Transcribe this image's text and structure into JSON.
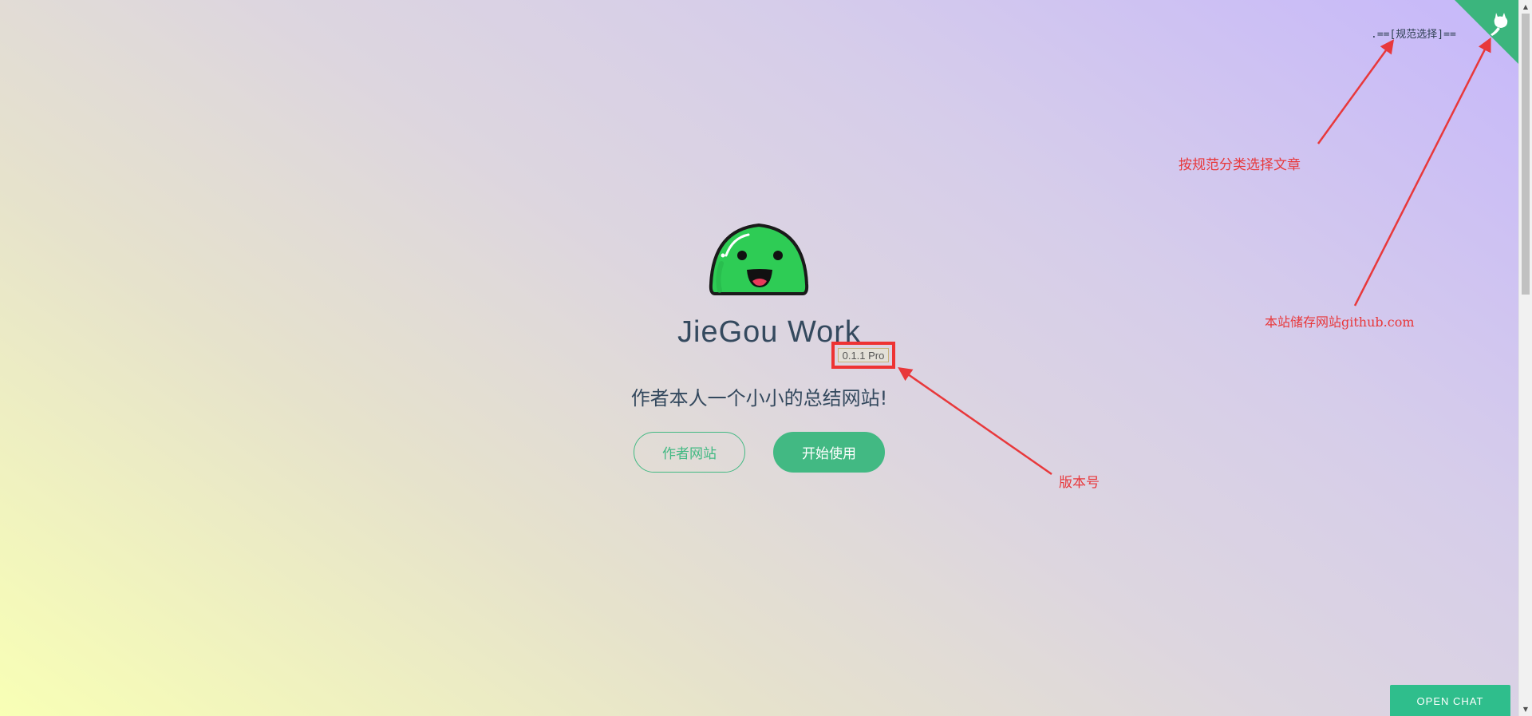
{
  "nav": {
    "category_link": ".==[规范选择]=="
  },
  "hero": {
    "title": "JieGou Work",
    "version": "0.1.1 Pro",
    "subtitle": "作者本人一个小小的总结网站!",
    "author_site_label": "作者网站",
    "get_started_label": "开始使用"
  },
  "annotations": {
    "category_note": "按规范分类选择文章",
    "repo_note": "本站储存网站github.com",
    "version_note": "版本号"
  },
  "chat": {
    "label": "OPEN CHAT"
  },
  "colors": {
    "accent": "#42b983",
    "annotation": "#e8383b",
    "ribbon": "#3bb57d"
  },
  "icons": {
    "corner": "github-cat-icon",
    "logo": "green-slime-mascot"
  }
}
